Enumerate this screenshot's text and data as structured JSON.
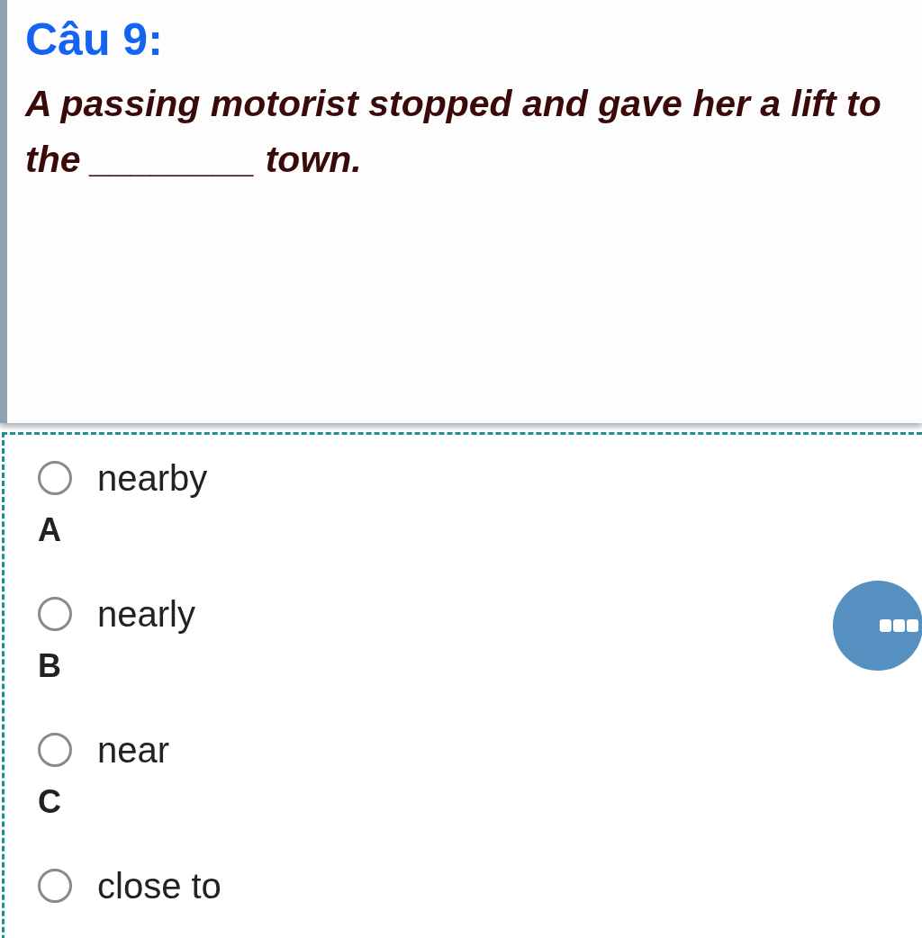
{
  "question": {
    "title": "Câu 9:",
    "text": "A passing motorist stopped and gave her a lift to the ________ town."
  },
  "options": [
    {
      "letter": "A",
      "text": "nearby",
      "selected": false
    },
    {
      "letter": "B",
      "text": "nearly",
      "selected": false
    },
    {
      "letter": "C",
      "text": "near",
      "selected": false
    },
    {
      "text": "close to",
      "selected": false
    }
  ]
}
